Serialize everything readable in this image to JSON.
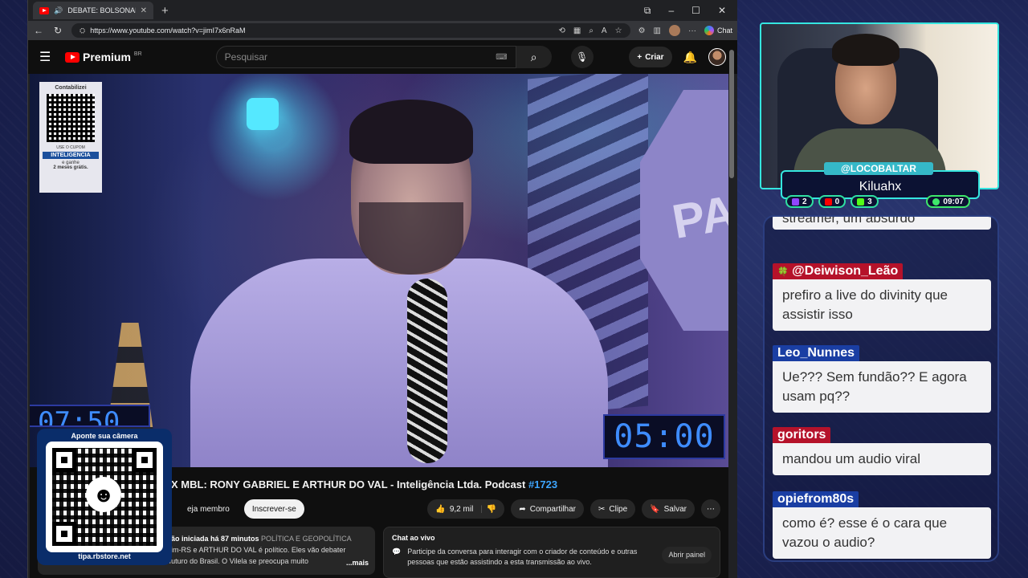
{
  "browser": {
    "tab_title": "DEBATE: BOLSONARISTA X M",
    "url": "https://www.youtube.com/watch?v=jimI7x6nRaM",
    "chat_label": "Chat"
  },
  "youtube": {
    "logo": "Premium",
    "region": "BR",
    "search_placeholder": "Pesquisar",
    "create_label": "Criar"
  },
  "video": {
    "sticker_title": "Contabilizei",
    "sticker_code_label": "USE O CUPOM",
    "sticker_code": "INTELIGENCIA",
    "sticker_line1": "e ganhe",
    "sticker_line2": "2 meses grátis.",
    "sign_text": "PAR",
    "timer_right": "05:00",
    "timer_left": "07:50"
  },
  "below": {
    "title_text": "X MBL: RONY GABRIEL E ARTHUR DO VAL - Inteligência Ltda. Podcast ",
    "title_hash": "#1723",
    "member_label": "eja membro",
    "subscribe_label": "Inscrever-se",
    "likes": "9,2 mil",
    "share_label": "Compartilhar",
    "clip_label": "Clipe",
    "save_label": "Salvar",
    "desc_line1_bold": "ão iniciada há 87 minutos",
    "desc_tags": "POLÍTICA E GEOPOLÍTICA",
    "desc_line2": "im-RS e ARTHUR DO VAL é político. Eles vão debater",
    "desc_line3": "obre Bolsonaro, o futuro da direita e o futuro do Brasil. O Vilela se preocupa muito",
    "desc_more": "...mais",
    "livechat_title": "Chat ao vivo",
    "livechat_text": "Participe da conversa para interagir com o criador de conteúdo e outras pessoas que estão assistindo a esta transmissão ao vivo.",
    "livechat_button": "Abrir painel"
  },
  "qr_overlay": {
    "label": "Aponte sua câmera",
    "url": "tipa.rbstore.net"
  },
  "streamer": {
    "handle": "@LOCOBALTAR",
    "name": "Kiluahx",
    "stat_twitch": "2",
    "stat_youtube": "0",
    "stat_kick": "3",
    "time": "09:07"
  },
  "chat": [
    {
      "user": "",
      "text": "streamer, um absurdo"
    },
    {
      "user": "@Deiwison_Leão",
      "text": "prefiro a live do divinity que assistir isso"
    },
    {
      "user": "Leo_Nunnes",
      "text": "Ue??? Sem fundão?? E agora usam pq??"
    },
    {
      "user": "goritors",
      "text": "mandou um audio viral"
    },
    {
      "user": "opiefrom80s",
      "text": "como é? esse é o cara que vazou o audio?"
    }
  ],
  "colors": {
    "accent_cyan": "#35e6e0",
    "youtube_red": "#ff0000",
    "timer_blue": "#3e8cff"
  }
}
